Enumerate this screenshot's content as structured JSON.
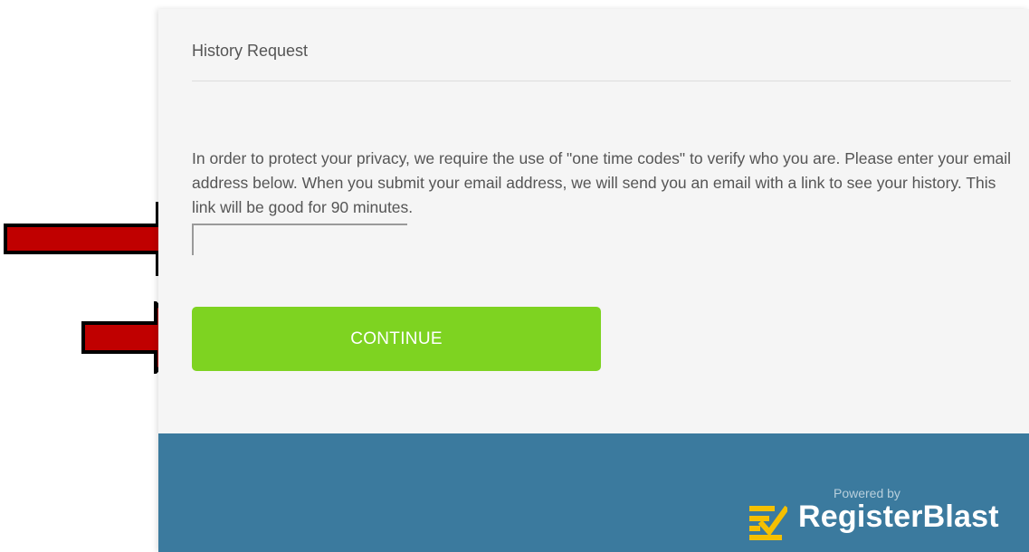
{
  "card": {
    "title": "History Request",
    "instructions": "In order to protect your privacy, we require the use of \"one time codes\" to verify who you are. Please enter your email address below. When you submit your email address, we will send you an email with a link to see your history. This link will be good for 90 minutes.",
    "email_value": "",
    "continue_label": "CONTINUE"
  },
  "footer": {
    "powered_by": "Powered by",
    "brand": "RegisterBlast",
    "brand_icon": "checklist-logo-icon"
  },
  "annotations": [
    {
      "target": "email-input",
      "icon": "red-arrow-icon",
      "color": "#c00000"
    },
    {
      "target": "continue-button",
      "icon": "red-arrow-icon",
      "color": "#c00000"
    }
  ],
  "colors": {
    "card_background": "#f5f5f5",
    "button_green": "#7ed321",
    "footer_blue": "#3b7a9e",
    "logo_yellow": "#f5c000",
    "arrow_red": "#c00000"
  }
}
